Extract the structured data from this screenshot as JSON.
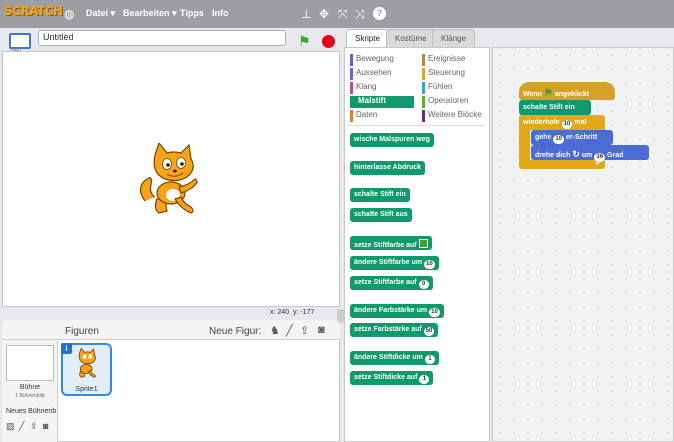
{
  "menubar": {
    "logo": "SCRATCH",
    "globe_icon": "globe-icon",
    "items": [
      "Datei ▾",
      "Bearbeiten ▾",
      "Tipps",
      "Info"
    ],
    "tool_icons": [
      "stamp-icon",
      "move-icon",
      "grow-icon",
      "shrink-icon",
      "help-icon"
    ]
  },
  "stage_header": {
    "project_title": "Untitled",
    "version": "v447"
  },
  "stage": {
    "coords_x_label": "x:",
    "coords_x": "240",
    "coords_y_label": "y:",
    "coords_y": "-177"
  },
  "sprite_pane": {
    "figures_label": "Figuren",
    "new_figure_label": "Neue Figur:",
    "stage_name": "Bühne",
    "stage_sub": "1 Bühnenbild",
    "new_backdrop_label": "Neues Bühnenb",
    "sprite_name": "Sprite1",
    "info_badge": "i"
  },
  "tabs": [
    "Skripte",
    "Kostüme",
    "Klänge"
  ],
  "categories": [
    {
      "label": "Bewegung",
      "color": "#4a6cd4"
    },
    {
      "label": "Ereignisse",
      "color": "#c88330"
    },
    {
      "label": "Aussehen",
      "color": "#8a55d7"
    },
    {
      "label": "Steuerung",
      "color": "#e1a91a"
    },
    {
      "label": "Klang",
      "color": "#bb42c3"
    },
    {
      "label": "Fühlen",
      "color": "#2ca5e2"
    },
    {
      "label": "Malstift",
      "color": "#0e9a6c"
    },
    {
      "label": "Operatoren",
      "color": "#5cb712"
    },
    {
      "label": "Daten",
      "color": "#ee7d16"
    },
    {
      "label": "Weitere Blöcke",
      "color": "#632d99"
    }
  ],
  "palette_blocks": [
    {
      "text": "wische Malspuren weg"
    },
    {
      "text": "hinterlasse Abdruck"
    },
    {
      "text": "schalte Stift ein"
    },
    {
      "text": "schalte Stift aus"
    },
    {
      "text": "setze Stiftfarbe auf"
    },
    {
      "text": "ändere Stiftfarbe um",
      "slot": "10"
    },
    {
      "text": "setze Stiftfarbe auf",
      "slot": "0"
    },
    {
      "text": "ändere Farbstärke um",
      "slot": "10"
    },
    {
      "text": "setze Farbstärke auf",
      "slot": "50"
    },
    {
      "text": "ändere Stiftdicke um",
      "slot": "1"
    },
    {
      "text": "setze Stiftdicke auf",
      "slot": "1"
    }
  ],
  "script": {
    "hat_before": "Wenn",
    "hat_after": "angeklickt",
    "pen_down": "schalte Stift ein",
    "repeat_before": "wiederhole",
    "repeat_count": "10",
    "repeat_after": "mal",
    "move_before": "gehe",
    "move_steps": "10",
    "move_after": "er-Schritt",
    "turn_before": "drehe dich",
    "turn_mid": "um",
    "turn_degrees": "36",
    "turn_after": "Grad"
  }
}
